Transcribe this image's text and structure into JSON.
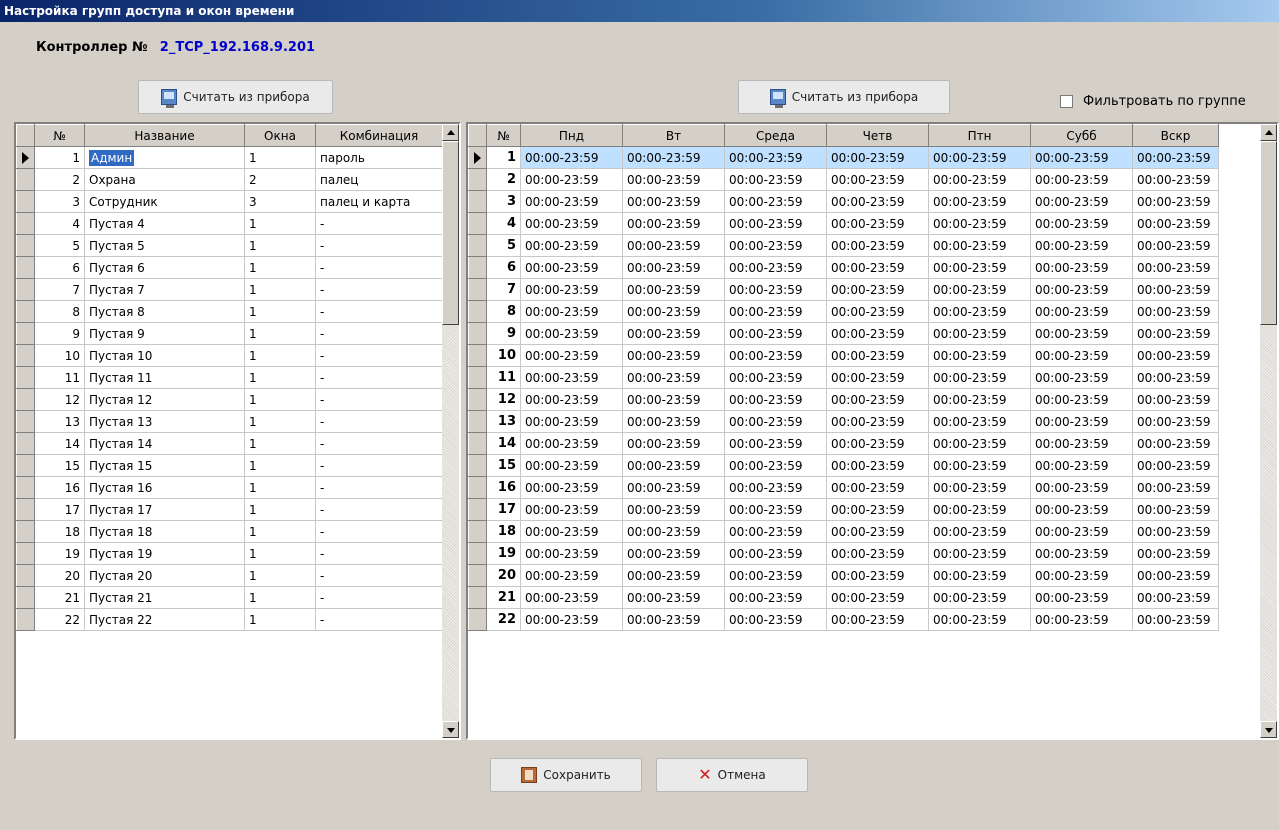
{
  "window": {
    "title": "Настройка групп доступа и окон времени"
  },
  "controller": {
    "label": "Контроллер №",
    "value": "2_TCP_192.168.9.201"
  },
  "left_panel": {
    "read_button": "Считать из прибора",
    "columns": [
      "№",
      "Название",
      "Окна",
      "Комбинация"
    ],
    "rows": [
      {
        "n": "1",
        "name": "Админ",
        "win": "1",
        "combo": "пароль"
      },
      {
        "n": "2",
        "name": "Охрана",
        "win": "2",
        "combo": "палец"
      },
      {
        "n": "3",
        "name": "Сотрудник",
        "win": "3",
        "combo": "палец и карта"
      },
      {
        "n": "4",
        "name": "Пустая 4",
        "win": "1",
        "combo": "-"
      },
      {
        "n": "5",
        "name": "Пустая 5",
        "win": "1",
        "combo": "-"
      },
      {
        "n": "6",
        "name": "Пустая 6",
        "win": "1",
        "combo": "-"
      },
      {
        "n": "7",
        "name": "Пустая 7",
        "win": "1",
        "combo": "-"
      },
      {
        "n": "8",
        "name": "Пустая 8",
        "win": "1",
        "combo": "-"
      },
      {
        "n": "9",
        "name": "Пустая 9",
        "win": "1",
        "combo": "-"
      },
      {
        "n": "10",
        "name": "Пустая 10",
        "win": "1",
        "combo": "-"
      },
      {
        "n": "11",
        "name": "Пустая 11",
        "win": "1",
        "combo": "-"
      },
      {
        "n": "12",
        "name": "Пустая 12",
        "win": "1",
        "combo": "-"
      },
      {
        "n": "13",
        "name": "Пустая 13",
        "win": "1",
        "combo": "-"
      },
      {
        "n": "14",
        "name": "Пустая 14",
        "win": "1",
        "combo": "-"
      },
      {
        "n": "15",
        "name": "Пустая 15",
        "win": "1",
        "combo": "-"
      },
      {
        "n": "16",
        "name": "Пустая 16",
        "win": "1",
        "combo": "-"
      },
      {
        "n": "17",
        "name": "Пустая 17",
        "win": "1",
        "combo": "-"
      },
      {
        "n": "18",
        "name": "Пустая 18",
        "win": "1",
        "combo": "-"
      },
      {
        "n": "19",
        "name": "Пустая 19",
        "win": "1",
        "combo": "-"
      },
      {
        "n": "20",
        "name": "Пустая 20",
        "win": "1",
        "combo": "-"
      },
      {
        "n": "21",
        "name": "Пустая 21",
        "win": "1",
        "combo": "-"
      },
      {
        "n": "22",
        "name": "Пустая 22",
        "win": "1",
        "combo": "-"
      }
    ]
  },
  "right_panel": {
    "read_button": "Считать из прибора",
    "filter_label": "Фильтровать по группе",
    "filter_checked": false,
    "columns": [
      "№",
      "Пнд",
      "Вт",
      "Среда",
      "Четв",
      "Птн",
      "Субб",
      "Вскр"
    ],
    "rows": [
      {
        "n": "1",
        "days": [
          "00:00-23:59",
          "00:00-23:59",
          "00:00-23:59",
          "00:00-23:59",
          "00:00-23:59",
          "00:00-23:59",
          "00:00-23:59"
        ]
      },
      {
        "n": "2",
        "days": [
          "00:00-23:59",
          "00:00-23:59",
          "00:00-23:59",
          "00:00-23:59",
          "00:00-23:59",
          "00:00-23:59",
          "00:00-23:59"
        ]
      },
      {
        "n": "3",
        "days": [
          "00:00-23:59",
          "00:00-23:59",
          "00:00-23:59",
          "00:00-23:59",
          "00:00-23:59",
          "00:00-23:59",
          "00:00-23:59"
        ]
      },
      {
        "n": "4",
        "days": [
          "00:00-23:59",
          "00:00-23:59",
          "00:00-23:59",
          "00:00-23:59",
          "00:00-23:59",
          "00:00-23:59",
          "00:00-23:59"
        ]
      },
      {
        "n": "5",
        "days": [
          "00:00-23:59",
          "00:00-23:59",
          "00:00-23:59",
          "00:00-23:59",
          "00:00-23:59",
          "00:00-23:59",
          "00:00-23:59"
        ]
      },
      {
        "n": "6",
        "days": [
          "00:00-23:59",
          "00:00-23:59",
          "00:00-23:59",
          "00:00-23:59",
          "00:00-23:59",
          "00:00-23:59",
          "00:00-23:59"
        ]
      },
      {
        "n": "7",
        "days": [
          "00:00-23:59",
          "00:00-23:59",
          "00:00-23:59",
          "00:00-23:59",
          "00:00-23:59",
          "00:00-23:59",
          "00:00-23:59"
        ]
      },
      {
        "n": "8",
        "days": [
          "00:00-23:59",
          "00:00-23:59",
          "00:00-23:59",
          "00:00-23:59",
          "00:00-23:59",
          "00:00-23:59",
          "00:00-23:59"
        ]
      },
      {
        "n": "9",
        "days": [
          "00:00-23:59",
          "00:00-23:59",
          "00:00-23:59",
          "00:00-23:59",
          "00:00-23:59",
          "00:00-23:59",
          "00:00-23:59"
        ]
      },
      {
        "n": "10",
        "days": [
          "00:00-23:59",
          "00:00-23:59",
          "00:00-23:59",
          "00:00-23:59",
          "00:00-23:59",
          "00:00-23:59",
          "00:00-23:59"
        ]
      },
      {
        "n": "11",
        "days": [
          "00:00-23:59",
          "00:00-23:59",
          "00:00-23:59",
          "00:00-23:59",
          "00:00-23:59",
          "00:00-23:59",
          "00:00-23:59"
        ]
      },
      {
        "n": "12",
        "days": [
          "00:00-23:59",
          "00:00-23:59",
          "00:00-23:59",
          "00:00-23:59",
          "00:00-23:59",
          "00:00-23:59",
          "00:00-23:59"
        ]
      },
      {
        "n": "13",
        "days": [
          "00:00-23:59",
          "00:00-23:59",
          "00:00-23:59",
          "00:00-23:59",
          "00:00-23:59",
          "00:00-23:59",
          "00:00-23:59"
        ]
      },
      {
        "n": "14",
        "days": [
          "00:00-23:59",
          "00:00-23:59",
          "00:00-23:59",
          "00:00-23:59",
          "00:00-23:59",
          "00:00-23:59",
          "00:00-23:59"
        ]
      },
      {
        "n": "15",
        "days": [
          "00:00-23:59",
          "00:00-23:59",
          "00:00-23:59",
          "00:00-23:59",
          "00:00-23:59",
          "00:00-23:59",
          "00:00-23:59"
        ]
      },
      {
        "n": "16",
        "days": [
          "00:00-23:59",
          "00:00-23:59",
          "00:00-23:59",
          "00:00-23:59",
          "00:00-23:59",
          "00:00-23:59",
          "00:00-23:59"
        ]
      },
      {
        "n": "17",
        "days": [
          "00:00-23:59",
          "00:00-23:59",
          "00:00-23:59",
          "00:00-23:59",
          "00:00-23:59",
          "00:00-23:59",
          "00:00-23:59"
        ]
      },
      {
        "n": "18",
        "days": [
          "00:00-23:59",
          "00:00-23:59",
          "00:00-23:59",
          "00:00-23:59",
          "00:00-23:59",
          "00:00-23:59",
          "00:00-23:59"
        ]
      },
      {
        "n": "19",
        "days": [
          "00:00-23:59",
          "00:00-23:59",
          "00:00-23:59",
          "00:00-23:59",
          "00:00-23:59",
          "00:00-23:59",
          "00:00-23:59"
        ]
      },
      {
        "n": "20",
        "days": [
          "00:00-23:59",
          "00:00-23:59",
          "00:00-23:59",
          "00:00-23:59",
          "00:00-23:59",
          "00:00-23:59",
          "00:00-23:59"
        ]
      },
      {
        "n": "21",
        "days": [
          "00:00-23:59",
          "00:00-23:59",
          "00:00-23:59",
          "00:00-23:59",
          "00:00-23:59",
          "00:00-23:59",
          "00:00-23:59"
        ]
      },
      {
        "n": "22",
        "days": [
          "00:00-23:59",
          "00:00-23:59",
          "00:00-23:59",
          "00:00-23:59",
          "00:00-23:59",
          "00:00-23:59",
          "00:00-23:59"
        ]
      }
    ]
  },
  "footer": {
    "save_label": "Сохранить",
    "cancel_label": "Отмена"
  },
  "icons": {
    "read": "computer-icon",
    "save": "door-icon",
    "cancel": "red-x-icon"
  },
  "colors": {
    "title_bar": "#0a246a",
    "controller_value": "#0000cc",
    "selection": "#316ac5",
    "highlight_row": "#bfe1ff"
  }
}
